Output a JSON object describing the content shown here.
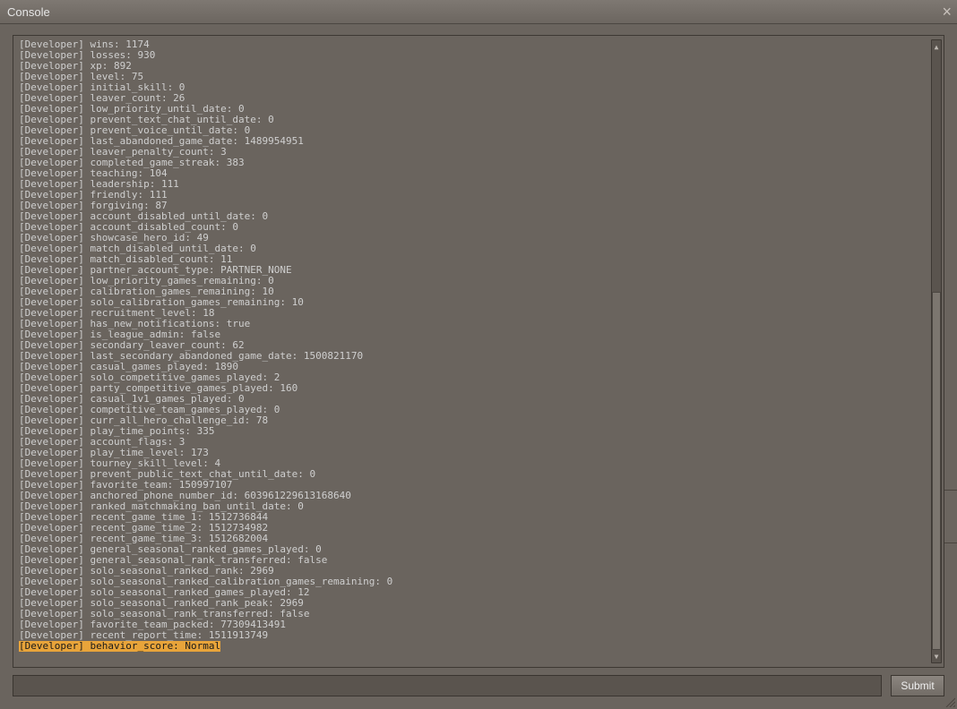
{
  "title": "Console",
  "submit_label": "Submit",
  "cmd_value": "",
  "highlight_index": 56,
  "lines": [
    "[Developer] wins: 1174",
    "[Developer] losses: 930",
    "[Developer] xp: 892",
    "[Developer] level: 75",
    "[Developer] initial_skill: 0",
    "[Developer] leaver_count: 26",
    "[Developer] low_priority_until_date: 0",
    "[Developer] prevent_text_chat_until_date: 0",
    "[Developer] prevent_voice_until_date: 0",
    "[Developer] last_abandoned_game_date: 1489954951",
    "[Developer] leaver_penalty_count: 3",
    "[Developer] completed_game_streak: 383",
    "[Developer] teaching: 104",
    "[Developer] leadership: 111",
    "[Developer] friendly: 111",
    "[Developer] forgiving: 87",
    "[Developer] account_disabled_until_date: 0",
    "[Developer] account_disabled_count: 0",
    "[Developer] showcase_hero_id: 49",
    "[Developer] match_disabled_until_date: 0",
    "[Developer] match_disabled_count: 11",
    "[Developer] partner_account_type: PARTNER_NONE",
    "[Developer] low_priority_games_remaining: 0",
    "[Developer] calibration_games_remaining: 10",
    "[Developer] solo_calibration_games_remaining: 10",
    "[Developer] recruitment_level: 18",
    "[Developer] has_new_notifications: true",
    "[Developer] is_league_admin: false",
    "[Developer] secondary_leaver_count: 62",
    "[Developer] last_secondary_abandoned_game_date: 1500821170",
    "[Developer] casual_games_played: 1890",
    "[Developer] solo_competitive_games_played: 2",
    "[Developer] party_competitive_games_played: 160",
    "[Developer] casual_1v1_games_played: 0",
    "[Developer] competitive_team_games_played: 0",
    "[Developer] curr_all_hero_challenge_id: 78",
    "[Developer] play_time_points: 335",
    "[Developer] account_flags: 3",
    "[Developer] play_time_level: 173",
    "[Developer] tourney_skill_level: 4",
    "[Developer] prevent_public_text_chat_until_date: 0",
    "[Developer] favorite_team: 150997107",
    "[Developer] anchored_phone_number_id: 603961229613168640",
    "[Developer] ranked_matchmaking_ban_until_date: 0",
    "[Developer] recent_game_time_1: 1512736844",
    "[Developer] recent_game_time_2: 1512734982",
    "[Developer] recent_game_time_3: 1512682004",
    "[Developer] general_seasonal_ranked_games_played: 0",
    "[Developer] general_seasonal_rank_transferred: false",
    "[Developer] solo_seasonal_ranked_rank: 2969",
    "[Developer] solo_seasonal_ranked_calibration_games_remaining: 0",
    "[Developer] solo_seasonal_ranked_games_played: 12",
    "[Developer] solo_seasonal_ranked_rank_peak: 2969",
    "[Developer] solo_seasonal_rank_transferred: false",
    "[Developer] favorite_team_packed: 77309413491",
    "[Developer] recent_report_time: 1511913749",
    "[Developer] behavior_score: Normal"
  ]
}
